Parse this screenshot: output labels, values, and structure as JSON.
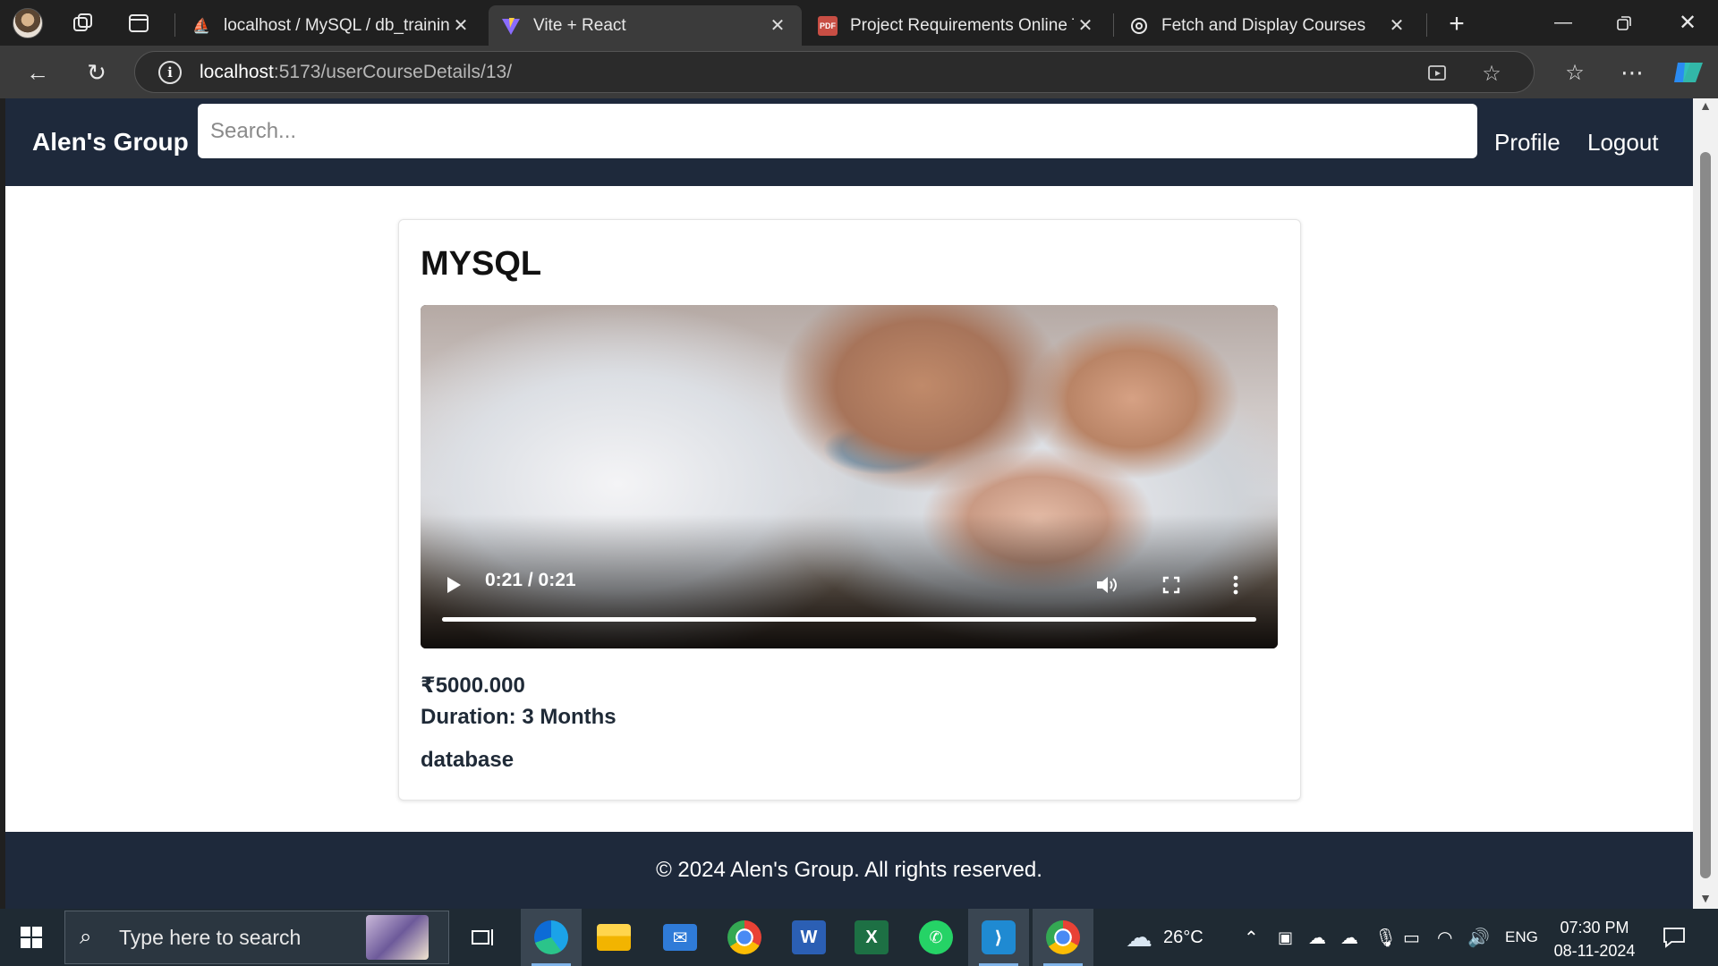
{
  "browser": {
    "tabs": [
      {
        "title": "localhost / MySQL / db_training",
        "icon": "phpmyadmin-icon"
      },
      {
        "title": "Vite + React",
        "icon": "vite-icon"
      },
      {
        "title": "Project Requirements Online Trai",
        "icon": "pdf-icon"
      },
      {
        "title": "Fetch and Display Courses",
        "icon": "chatgpt-icon"
      }
    ],
    "active_tab_index": 1,
    "url_host": "localhost",
    "url_rest": ":5173/userCourseDetails/13/"
  },
  "header": {
    "brand": "Alen's Group",
    "search_placeholder": "Search...",
    "profile_label": "Profile",
    "logout_label": "Logout"
  },
  "course": {
    "title": "MYSQL",
    "video": {
      "time_label": "0:21 / 0:21",
      "progress": 1.0
    },
    "price": "₹5000.000",
    "duration": "Duration: 3 Months",
    "category": "database"
  },
  "footer": {
    "text": "© 2024 Alen's Group. All rights reserved."
  },
  "taskbar": {
    "search_placeholder": "Type here to search",
    "weather": "26°C",
    "language": "ENG",
    "time": "07:30 PM",
    "date": "08-11-2024"
  },
  "colors": {
    "header_bg": "#1e293b",
    "footer_bg": "#1e293b",
    "chrome_bg": "#202020",
    "taskbar_bg": "#1f2a33"
  }
}
